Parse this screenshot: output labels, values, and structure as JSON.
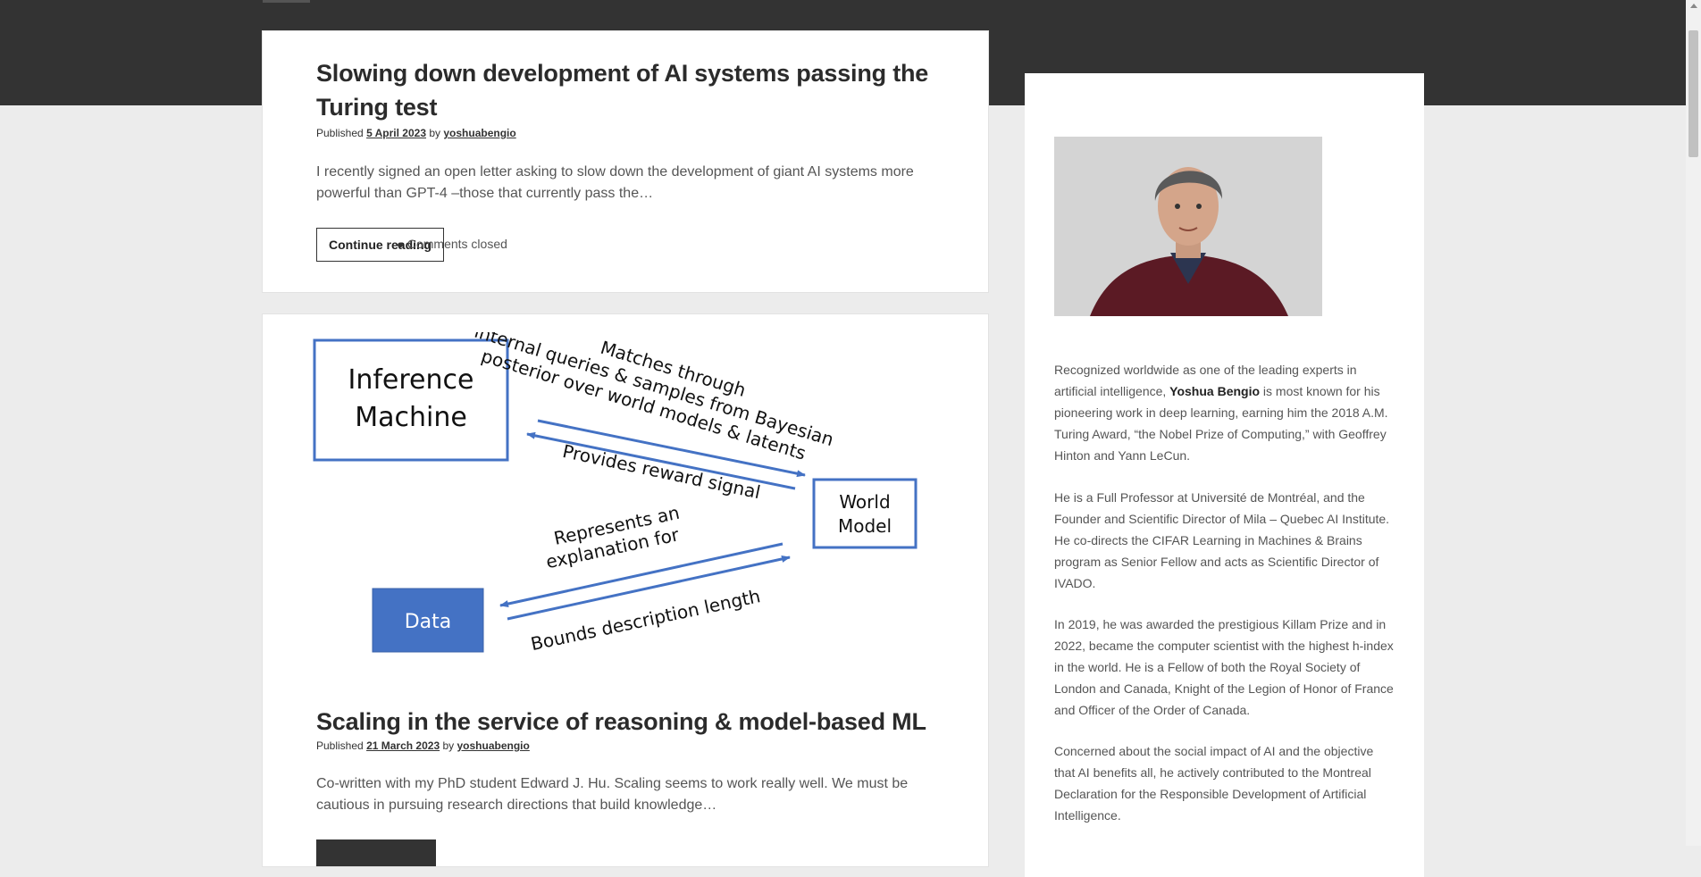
{
  "posts": [
    {
      "title": "Slowing down development of AI systems passing the Turing test",
      "published_label": "Published",
      "date": "5 April 2023",
      "by_label": "by",
      "author": "yoshuabengio",
      "excerpt": "I recently signed an open letter asking to slow down the development of giant AI systems more powerful than GPT-4  –those that currently pass the…",
      "button_label": "Continue reading",
      "comments": "Comments closed"
    },
    {
      "title": "Scaling in the service of reasoning & model-based ML",
      "published_label": "Published",
      "date": "21 March 2023",
      "by_label": "by",
      "author": "yoshuabengio",
      "excerpt": "Co-written with my PhD student Edward J. Hu. Scaling seems to work really well. We must be cautious in pursuing research directions that build knowledge…",
      "diagram": {
        "inference_line1": "Inference",
        "inference_line2": "Machine",
        "world_line1": "World",
        "world_line2": "Model",
        "data_label": "Data",
        "arrow1_line1": "Matches through",
        "arrow1_line2": "internal queries & samples from Bayesian",
        "arrow1_line3": "posterior over world models & latents",
        "arrow2": "Provides reward signal",
        "arrow3_line1": "Represents an",
        "arrow3_line2": "explanation for",
        "arrow4": "Bounds description length"
      }
    }
  ],
  "sidebar": {
    "bio": {
      "p1_before": "Recognized worldwide as one of the leading experts in artificial intelligence, ",
      "p1_name": "Yoshua Bengio",
      "p1_after": " is most known for his pioneering work in deep learning, earning him the 2018 A.M. Turing Award, “the Nobel Prize of Computing,” with Geoffrey Hinton and Yann LeCun.",
      "p2": "He is a Full Professor at Université de Montréal, and the Founder and Scientific Director of Mila – Quebec AI Institute. He co-directs the CIFAR Learning in Machines & Brains program as Senior Fellow and acts as Scientific Director of IVADO.",
      "p3": "In 2019, he was awarded the prestigious Killam Prize and in 2022, became the computer scientist with the highest h-index in the world. He is a Fellow of both the Royal Society of London and Canada, Knight of the Legion of Honor of France and Officer of the Order of Canada.",
      "p4": "Concerned about the social impact of AI and the objective that AI benefits all, he actively contributed to the Montreal Declaration for the Responsible Development of Artificial Intelligence."
    }
  },
  "colors": {
    "header_band": "#333333",
    "diagram_blue": "#4472c4",
    "data_box_fill": "#4472c4"
  }
}
